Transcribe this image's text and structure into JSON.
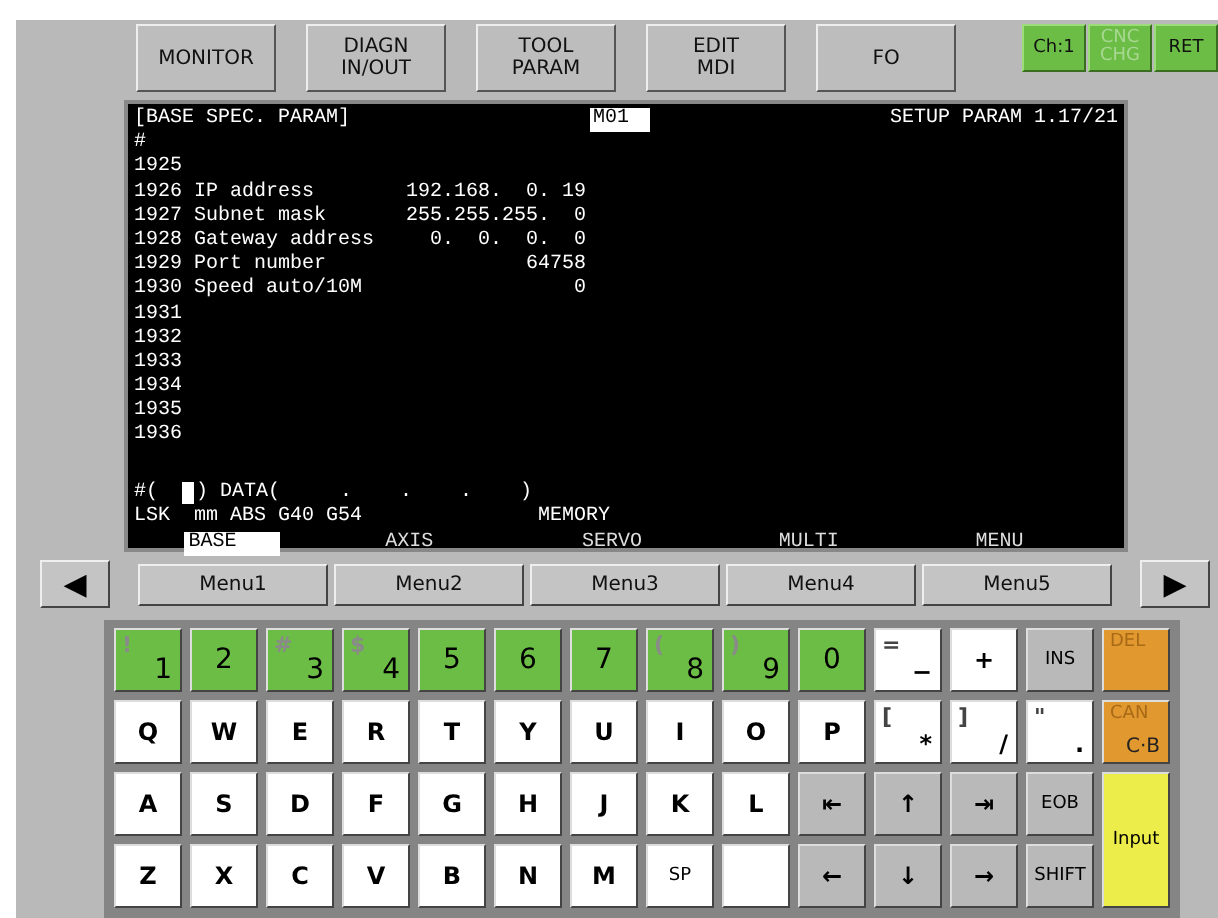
{
  "top_buttons": [
    {
      "lines": [
        "MONITOR"
      ]
    },
    {
      "lines": [
        "DIAGN",
        "IN/OUT"
      ]
    },
    {
      "lines": [
        "TOOL",
        "PARAM"
      ]
    },
    {
      "lines": [
        "EDIT",
        "MDI"
      ]
    },
    {
      "lines": [
        "FO"
      ]
    }
  ],
  "status_buttons": [
    {
      "lines": [
        "Ch:1"
      ],
      "disabled": false
    },
    {
      "lines": [
        "CNC",
        "CHG"
      ],
      "disabled": true
    },
    {
      "lines": [
        "RET"
      ],
      "disabled": false
    }
  ],
  "screen": {
    "title": "[BASE SPEC. PARAM]",
    "mode": "M01",
    "page": "SETUP PARAM 1.17/21",
    "hash": "#",
    "params": [
      {
        "number": "1925"
      },
      {
        "number": "1926",
        "name": "IP address",
        "value": "192.168.  0. 19"
      },
      {
        "number": "1927",
        "name": "Subnet mask",
        "value": "255.255.255.  0"
      },
      {
        "number": "1928",
        "name": "Gateway address",
        "value": "0.  0.  0.  0"
      },
      {
        "number": "1929",
        "name": "Port number",
        "value": "64758"
      },
      {
        "number": "1930",
        "name": "Speed auto/10M",
        "value": "0"
      },
      {
        "number": "1931"
      },
      {
        "number": "1932"
      },
      {
        "number": "1933"
      },
      {
        "number": "1934"
      },
      {
        "number": "1935"
      },
      {
        "number": "1936"
      }
    ],
    "input_prefix": "#(",
    "input_suffix": ") DATA(     .    .    .    )",
    "modal": "LSK  mm ABS G40 G54",
    "memory": "MEMORY",
    "soft_tabs": [
      {
        "label": "BASE",
        "selected": true
      },
      {
        "label": "AXIS",
        "selected": false
      },
      {
        "label": "SERVO",
        "selected": false
      },
      {
        "label": "MULTI",
        "selected": false
      },
      {
        "label": "MENU",
        "selected": false
      }
    ]
  },
  "menu_left": "◀",
  "menu_right": "▶",
  "menus": [
    "Menu1",
    "Menu2",
    "Menu3",
    "Menu4",
    "Menu5"
  ],
  "keys": [
    {
      "shift": "!",
      "main": "1",
      "kind": "green"
    },
    {
      "main": "2",
      "kind": "green"
    },
    {
      "shift": "#",
      "main": "3",
      "kind": "green"
    },
    {
      "shift": "$",
      "main": "4",
      "kind": "green"
    },
    {
      "main": "5",
      "kind": "green"
    },
    {
      "main": "6",
      "kind": "green"
    },
    {
      "main": "7",
      "kind": "green"
    },
    {
      "shift": "(",
      "main": "8",
      "kind": "green"
    },
    {
      "shift": ")",
      "main": "9",
      "kind": "green"
    },
    {
      "main": "0",
      "kind": "green"
    },
    {
      "shift": "=",
      "main": "−",
      "kind": "white"
    },
    {
      "main": "+",
      "kind": "white"
    },
    {
      "main": "INS",
      "kind": "gray"
    },
    {
      "shift": "DEL",
      "kind": "orange"
    },
    {
      "main": "Q",
      "kind": "white"
    },
    {
      "main": "W",
      "kind": "white"
    },
    {
      "main": "E",
      "kind": "white"
    },
    {
      "main": "R",
      "kind": "white"
    },
    {
      "main": "T",
      "kind": "white"
    },
    {
      "main": "Y",
      "kind": "white"
    },
    {
      "main": "U",
      "kind": "white"
    },
    {
      "main": "I",
      "kind": "white"
    },
    {
      "main": "O",
      "kind": "white"
    },
    {
      "main": "P",
      "kind": "white"
    },
    {
      "shift": "[",
      "main": "*",
      "kind": "white"
    },
    {
      "shift": "]",
      "main": "/",
      "kind": "white"
    },
    {
      "shift": "\"",
      "main": ".",
      "kind": "white"
    },
    {
      "shift": "CAN",
      "main": "C·B",
      "kind": "orange"
    },
    {
      "main": "A",
      "kind": "white"
    },
    {
      "main": "S",
      "kind": "white"
    },
    {
      "main": "D",
      "kind": "white"
    },
    {
      "main": "F",
      "kind": "white"
    },
    {
      "main": "G",
      "kind": "white"
    },
    {
      "main": "H",
      "kind": "white"
    },
    {
      "main": "J",
      "kind": "white"
    },
    {
      "main": "K",
      "kind": "white"
    },
    {
      "main": "L",
      "kind": "white"
    },
    {
      "main": "⇤",
      "kind": "gray"
    },
    {
      "main": "↑",
      "kind": "gray"
    },
    {
      "main": "⇥",
      "kind": "gray"
    },
    {
      "main": "EOB",
      "kind": "gray"
    },
    {
      "main": "Input",
      "kind": "yellow"
    },
    {
      "main": "Z",
      "kind": "white"
    },
    {
      "main": "X",
      "kind": "white"
    },
    {
      "main": "C",
      "kind": "white"
    },
    {
      "main": "V",
      "kind": "white"
    },
    {
      "main": "B",
      "kind": "white"
    },
    {
      "main": "N",
      "kind": "white"
    },
    {
      "main": "M",
      "kind": "white"
    },
    {
      "main": "SP",
      "kind": "white"
    },
    {
      "kind": "white"
    },
    {
      "main": "←",
      "kind": "gray"
    },
    {
      "main": "↓",
      "kind": "gray"
    },
    {
      "main": "→",
      "kind": "gray"
    },
    {
      "main": "SHIFT",
      "kind": "gray"
    }
  ]
}
